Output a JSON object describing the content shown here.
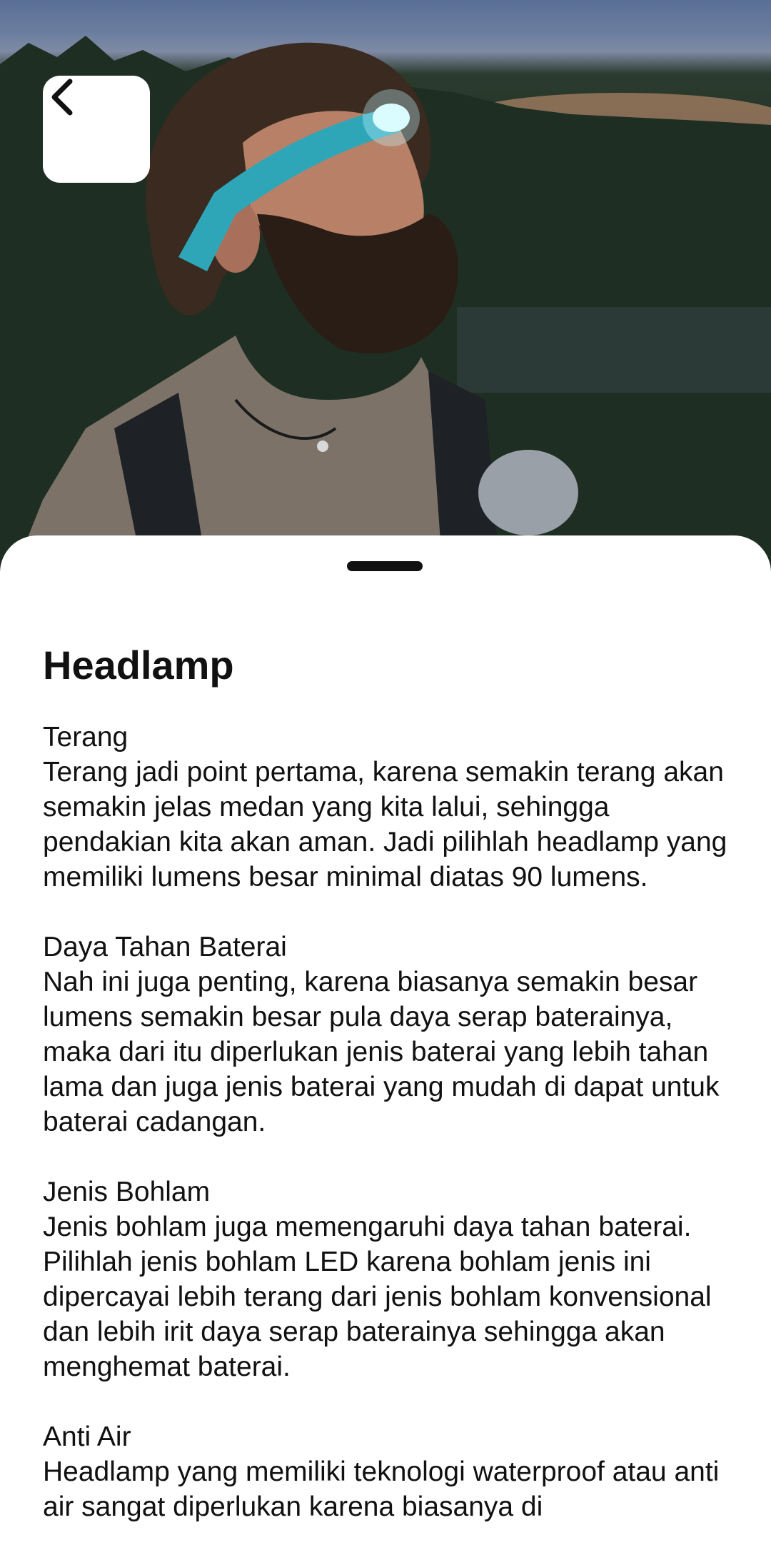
{
  "colors": {
    "background": "#ffffff",
    "text": "#111111",
    "headband": "#2fa6b8"
  },
  "header": {
    "back_icon": "chevron-left-icon"
  },
  "article": {
    "title": "Headlamp",
    "sections": [
      {
        "heading": "Terang",
        "body": "Terang jadi point pertama, karena semakin terang akan semakin jelas medan yang kita lalui, sehingga pendakian kita akan aman. Jadi pilihlah headlamp yang memiliki lumens besar minimal diatas 90 lumens."
      },
      {
        "heading": "Daya Tahan Baterai",
        "body": "Nah ini juga penting, karena biasanya semakin besar lumens semakin besar pula daya serap baterainya, maka dari itu diperlukan jenis baterai yang lebih tahan lama dan juga jenis baterai yang mudah di dapat untuk baterai cadangan."
      },
      {
        "heading": "Jenis Bohlam",
        "body": "Jenis bohlam juga memengaruhi daya tahan baterai. Pilihlah jenis bohlam LED karena bohlam jenis ini dipercayai lebih terang dari jenis bohlam konvensional dan lebih irit daya serap baterainya sehingga akan menghemat baterai."
      },
      {
        "heading": "Anti Air",
        "body": "Headlamp yang memiliki teknologi waterproof atau anti air sangat diperlukan karena biasanya di"
      }
    ]
  }
}
